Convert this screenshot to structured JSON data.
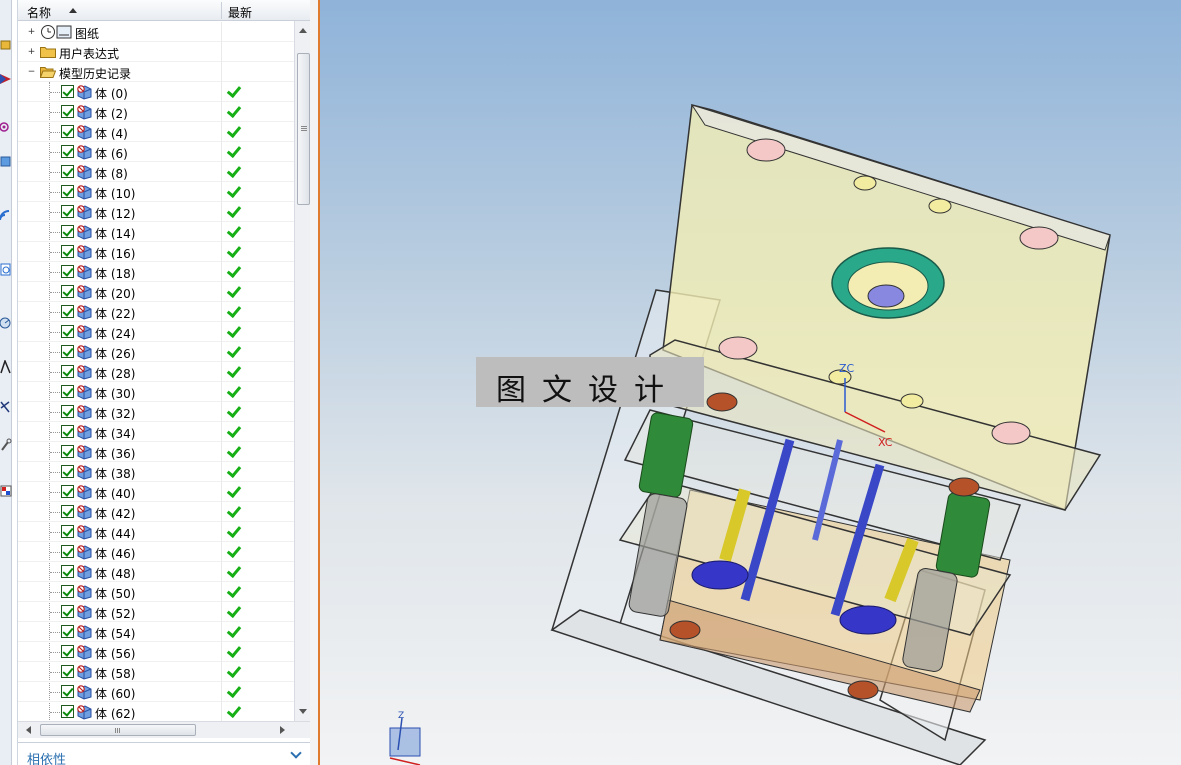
{
  "navigator": {
    "header": {
      "name_col": "名称",
      "latest_col": "最新"
    },
    "top_items": [
      {
        "label": "图纸"
      },
      {
        "label": "用户表达式"
      },
      {
        "label": "模型历史记录"
      }
    ],
    "history_items": [
      {
        "label": "体 (0)"
      },
      {
        "label": "体 (2)"
      },
      {
        "label": "体 (4)"
      },
      {
        "label": "体 (6)"
      },
      {
        "label": "体 (8)"
      },
      {
        "label": "体 (10)"
      },
      {
        "label": "体 (12)"
      },
      {
        "label": "体 (14)"
      },
      {
        "label": "体 (16)"
      },
      {
        "label": "体 (18)"
      },
      {
        "label": "体 (20)"
      },
      {
        "label": "体 (22)"
      },
      {
        "label": "体 (24)"
      },
      {
        "label": "体 (26)"
      },
      {
        "label": "体 (28)"
      },
      {
        "label": "体 (30)"
      },
      {
        "label": "体 (32)"
      },
      {
        "label": "体 (34)"
      },
      {
        "label": "体 (36)"
      },
      {
        "label": "体 (38)"
      },
      {
        "label": "体 (40)"
      },
      {
        "label": "体 (42)"
      },
      {
        "label": "体 (44)"
      },
      {
        "label": "体 (46)"
      },
      {
        "label": "体 (48)"
      },
      {
        "label": "体 (50)"
      },
      {
        "label": "体 (52)"
      },
      {
        "label": "体 (54)"
      },
      {
        "label": "体 (56)"
      },
      {
        "label": "体 (58)"
      },
      {
        "label": "体 (60)"
      },
      {
        "label": "体 (62)"
      }
    ],
    "dependency_title": "相依性"
  },
  "viewport": {
    "watermark": "图文设计",
    "axis_labels": {
      "zc": "ZC",
      "xc": "XC",
      "triad_z": "Z"
    }
  },
  "colors": {
    "accent_orange": "#e07a2c",
    "check_green": "#16b016",
    "dependency_blue": "#2a6fb0",
    "mold_plate_yellow": "#f3edb4",
    "ring_teal": "#2aa88a"
  }
}
